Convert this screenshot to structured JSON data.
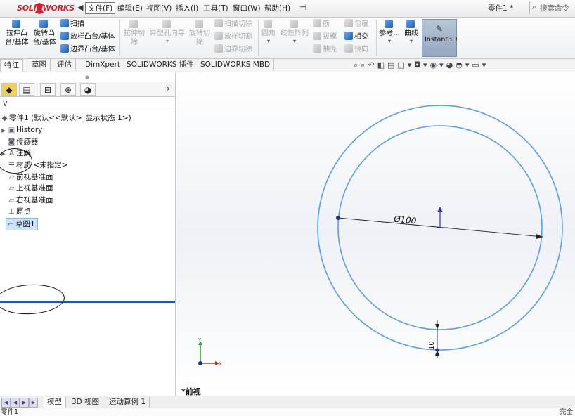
{
  "titlebar": {
    "logo": "SOLIDWORKS",
    "menu": [
      "文件(F)",
      "编辑(E)",
      "视图(V)",
      "插入(I)",
      "工具(T)",
      "窗口(W)",
      "帮助(H)"
    ],
    "doc_title": "零件1 *",
    "search_placeholder": "搜索命令"
  },
  "commands": {
    "extrude_boss": [
      "拉伸凸",
      "台/基体"
    ],
    "revolve_boss": [
      "旋转凸",
      "台/基体"
    ],
    "sweep": "扫描",
    "loft_boss": "放样凸台/基体",
    "boundary_boss": "边界凸台/基体",
    "extrude_cut": [
      "拉伸切",
      "除"
    ],
    "hole_wizard": "异型孔向导",
    "revolve_cut": [
      "旋转切",
      "除"
    ],
    "sweep_cut": "扫描切除",
    "loft_cut": "放样切割",
    "boundary_cut": "边界切除",
    "fillet": "圆角",
    "linear_pattern": "线性阵列",
    "rib": "筋",
    "draft": "拔模",
    "shell": "抽壳",
    "wrap": "包覆",
    "intersect": "相交",
    "mirror": "镜向",
    "reference": "参考...",
    "curves": "曲线",
    "instant3d": "Instant3D"
  },
  "tabs": [
    "特征",
    "草图",
    "评估",
    "DimXpert",
    "SOLIDWORKS 插件",
    "SOLIDWORKS MBD"
  ],
  "tree": {
    "root": "零件1 (默认<<默认>_显示状态 1>)",
    "items": [
      "History",
      "传感器",
      "注解",
      "材质 <未指定>",
      "前视基准面",
      "上视基准面",
      "右视基准面",
      "原点",
      "草图1"
    ]
  },
  "graphics": {
    "dimension_diameter": "Ø100",
    "dimension_offset": "10",
    "view_label": "*前视",
    "axis_x": "X",
    "axis_y": "Y",
    "sketch_color": "#5a9ee8"
  },
  "bottom_tabs": [
    "模型",
    "3D 视图",
    "运动算例 1"
  ],
  "status": {
    "left": "零件1",
    "right": "完全"
  }
}
